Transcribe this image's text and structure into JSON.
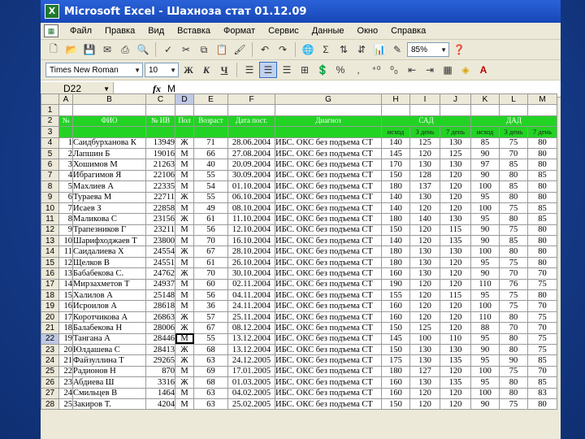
{
  "window": {
    "title": "Microsoft Excel - Шахноза стат 01.12.09"
  },
  "menu": [
    "Файл",
    "Правка",
    "Вид",
    "Вставка",
    "Формат",
    "Сервис",
    "Данные",
    "Окно",
    "Справка"
  ],
  "toolbar": {
    "zoom": "85%",
    "font": "Times New Roman",
    "size": "10",
    "bold": "Ж",
    "italic": "К",
    "underline": "Ч",
    "percent": "%"
  },
  "formula": {
    "cell": "D22",
    "fx": "fx",
    "value": "М"
  },
  "columns": [
    "A",
    "B",
    "C",
    "D",
    "E",
    "F",
    "G",
    "H",
    "I",
    "J",
    "K",
    "L",
    "M"
  ],
  "selected_column": "D",
  "headers": {
    "num": "№",
    "fio": "ФИО",
    "ib": "№ ИВ",
    "sex": "Пол",
    "age": "Возраст",
    "date": "Дата пост.",
    "diag": "Диагноз",
    "sad": "САД",
    "dad": "ДАД",
    "sub": [
      "исход",
      "3 день",
      "7 день",
      "исход",
      "3 день",
      "7 день"
    ]
  },
  "rows": [
    {
      "r": "4",
      "n": "1",
      "fio": "Саидбурханова К",
      "ib": "13949",
      "sex": "Ж",
      "age": "71",
      "date": "28.06.2004",
      "diag": "ИБС. ОКС без подъема СТ",
      "v": [
        "140",
        "125",
        "130",
        "85",
        "75",
        "80"
      ]
    },
    {
      "r": "5",
      "n": "2",
      "fio": "Лапшин Б",
      "ib": "19016",
      "sex": "М",
      "age": "66",
      "date": "27.08.2004",
      "diag": "ИБС. ОКС без подъема СТ",
      "v": [
        "145",
        "120",
        "125",
        "90",
        "70",
        "80"
      ]
    },
    {
      "r": "6",
      "n": "3",
      "fio": "Хошимов М",
      "ib": "21263",
      "sex": "М",
      "age": "40",
      "date": "20.09.2004",
      "diag": "ИБС. ОКС без подъема СТ",
      "v": [
        "170",
        "130",
        "130",
        "97",
        "85",
        "80"
      ]
    },
    {
      "r": "7",
      "n": "4",
      "fio": "Ибрагимов Я",
      "ib": "22106",
      "sex": "М",
      "age": "55",
      "date": "30.09.2004",
      "diag": "ИБС. ОКС без подъема СТ",
      "v": [
        "150",
        "128",
        "120",
        "90",
        "80",
        "85"
      ]
    },
    {
      "r": "8",
      "n": "5",
      "fio": "Махлиев А",
      "ib": "22335",
      "sex": "М",
      "age": "54",
      "date": "01.10.2004",
      "diag": "ИБС. ОКС без подъема СТ",
      "v": [
        "180",
        "137",
        "120",
        "100",
        "85",
        "80"
      ]
    },
    {
      "r": "9",
      "n": "6",
      "fio": "Тураева М",
      "ib": "22711",
      "sex": "Ж",
      "age": "55",
      "date": "06.10.2004",
      "diag": "ИБС. ОКС без подъема СТ",
      "v": [
        "140",
        "130",
        "120",
        "95",
        "80",
        "80"
      ]
    },
    {
      "r": "10",
      "n": "7",
      "fio": "Исаев З",
      "ib": "22858",
      "sex": "М",
      "age": "49",
      "date": "08.10.2004",
      "diag": "ИБС. ОКС без подъема СТ",
      "v": [
        "140",
        "120",
        "120",
        "100",
        "75",
        "85"
      ]
    },
    {
      "r": "11",
      "n": "8",
      "fio": "Маликова С",
      "ib": "23156",
      "sex": "Ж",
      "age": "61",
      "date": "11.10.2004",
      "diag": "ИБС. ОКС без подъема СТ",
      "v": [
        "180",
        "140",
        "130",
        "95",
        "80",
        "85"
      ]
    },
    {
      "r": "12",
      "n": "9",
      "fio": "Трапезников Г",
      "ib": "23211",
      "sex": "М",
      "age": "56",
      "date": "12.10.2004",
      "diag": "ИБС. ОКС без подъема СТ",
      "v": [
        "150",
        "120",
        "115",
        "90",
        "75",
        "80"
      ]
    },
    {
      "r": "13",
      "n": "10",
      "fio": "Шарифходжаев Т",
      "ib": "23800",
      "sex": "М",
      "age": "70",
      "date": "16.10.2004",
      "diag": "ИБС. ОКС без подъема СТ",
      "v": [
        "140",
        "120",
        "135",
        "90",
        "85",
        "80"
      ]
    },
    {
      "r": "14",
      "n": "11",
      "fio": "Саидалиева Х",
      "ib": "24554",
      "sex": "Ж",
      "age": "67",
      "date": "28.10.2004",
      "diag": "ИБС. ОКС без подъема СТ",
      "v": [
        "180",
        "130",
        "130",
        "100",
        "80",
        "80"
      ]
    },
    {
      "r": "15",
      "n": "12",
      "fio": "Щелков В",
      "ib": "24551",
      "sex": "М",
      "age": "61",
      "date": "26.10.2004",
      "diag": "ИБС. ОКС без подъема СТ",
      "v": [
        "180",
        "130",
        "120",
        "95",
        "75",
        "80"
      ]
    },
    {
      "r": "16",
      "n": "13",
      "fio": "Бабабекова С.",
      "ib": "24762",
      "sex": "Ж",
      "age": "70",
      "date": "30.10.2004",
      "diag": "ИБС. ОКС без подъема СТ",
      "v": [
        "160",
        "130",
        "120",
        "90",
        "70",
        "70"
      ]
    },
    {
      "r": "17",
      "n": "14",
      "fio": "Мирзахметов Т",
      "ib": "24937",
      "sex": "М",
      "age": "60",
      "date": "02.11.2004",
      "diag": "ИБС. ОКС без подъема СТ",
      "v": [
        "190",
        "120",
        "120",
        "110",
        "76",
        "75"
      ]
    },
    {
      "r": "18",
      "n": "15",
      "fio": "Халилов А",
      "ib": "25148",
      "sex": "М",
      "age": "56",
      "date": "04.11.2004",
      "diag": "ИБС. ОКС без подъема СТ",
      "v": [
        "155",
        "120",
        "115",
        "95",
        "75",
        "80"
      ]
    },
    {
      "r": "19",
      "n": "16",
      "fio": "Исроилов А",
      "ib": "28618",
      "sex": "М",
      "age": "36",
      "date": "24.11.2004",
      "diag": "ИБС. ОКС без подъема СТ",
      "v": [
        "160",
        "120",
        "120",
        "100",
        "75",
        "70"
      ]
    },
    {
      "r": "20",
      "n": "17",
      "fio": "Коротчикова А",
      "ib": "26863",
      "sex": "Ж",
      "age": "57",
      "date": "25.11.2004",
      "diag": "ИБС. ОКС без подъема СТ",
      "v": [
        "160",
        "120",
        "120",
        "110",
        "80",
        "75"
      ]
    },
    {
      "r": "21",
      "n": "18",
      "fio": "Балабекова Н",
      "ib": "28006",
      "sex": "Ж",
      "age": "67",
      "date": "08.12.2004",
      "diag": "ИБС. ОКС без подъема СТ",
      "v": [
        "150",
        "125",
        "120",
        "88",
        "70",
        "70"
      ]
    },
    {
      "r": "22",
      "n": "19",
      "fio": "Тангана А",
      "ib": "28446",
      "sex": "М",
      "age": "55",
      "date": "13.12.2004",
      "diag": "ИБС. ОКС без подъема СТ",
      "v": [
        "145",
        "100",
        "110",
        "95",
        "80",
        "75"
      ]
    },
    {
      "r": "23",
      "n": "20",
      "fio": "Юлдашева С",
      "ib": "28413",
      "sex": "Ж",
      "age": "68",
      "date": "13.12.2004",
      "diag": "ИБС. ОКС без подъема СТ",
      "v": [
        "150",
        "130",
        "130",
        "90",
        "80",
        "75"
      ]
    },
    {
      "r": "24",
      "n": "21",
      "fio": "Файзуллина Т",
      "ib": "29265",
      "sex": "Ж",
      "age": "63",
      "date": "24.12.2005",
      "diag": "ИБС. ОКС без подъема СТ",
      "v": [
        "175",
        "130",
        "135",
        "95",
        "90",
        "85"
      ]
    },
    {
      "r": "25",
      "n": "22",
      "fio": "Радионов Н",
      "ib": "870",
      "sex": "М",
      "age": "69",
      "date": "17.01.2005",
      "diag": "ИБС. ОКС без подъема СТ",
      "v": [
        "180",
        "127",
        "120",
        "100",
        "75",
        "70"
      ]
    },
    {
      "r": "26",
      "n": "23",
      "fio": "Абдиева Ш",
      "ib": "3316",
      "sex": "Ж",
      "age": "68",
      "date": "01.03.2005",
      "diag": "ИБС. ОКС без подъема СТ",
      "v": [
        "160",
        "130",
        "135",
        "95",
        "80",
        "85"
      ]
    },
    {
      "r": "27",
      "n": "24",
      "fio": "Смильцев В",
      "ib": "1464",
      "sex": "М",
      "age": "63",
      "date": "04.02.2005",
      "diag": "ИБС. ОКС без подъема СТ",
      "v": [
        "160",
        "120",
        "120",
        "100",
        "80",
        "83"
      ]
    },
    {
      "r": "28",
      "n": "25",
      "fio": "Закиров Т.",
      "ib": "4204",
      "sex": "М",
      "age": "63",
      "date": "25.02.2005",
      "diag": "ИБС. ОКС без подъема СТ",
      "v": [
        "150",
        "120",
        "120",
        "90",
        "75",
        "80"
      ]
    }
  ]
}
